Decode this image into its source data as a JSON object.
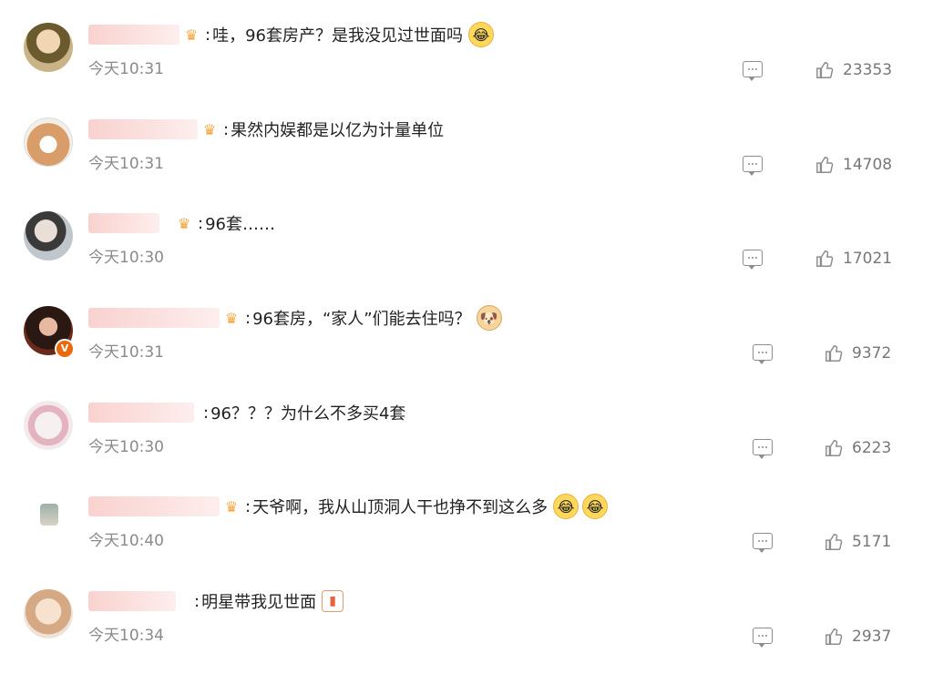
{
  "comments": [
    {
      "avatar": "user-avatar",
      "name_blur_w": 100,
      "vip": true,
      "text": "哇，96套房产？是我没见过世面吗",
      "emojis": [
        "crying-laughing-emoji"
      ],
      "time": "今天10:31",
      "likes": "23353"
    },
    {
      "avatar": "user-avatar",
      "name_blur_w": 120,
      "vip": true,
      "text": "果然内娱都是以亿为计量单位",
      "emojis": [],
      "time": "今天10:31",
      "likes": "14708"
    },
    {
      "avatar": "user-avatar",
      "name_blur_w": 78,
      "vip": true,
      "text": "96套……",
      "emojis": [],
      "time": "今天10:30",
      "likes": "17021"
    },
    {
      "avatar": "user-avatar",
      "name_blur_w": 144,
      "vip": true,
      "verified": "V",
      "text": "96套房，“家人”们能去住吗？",
      "emojis": [
        "doge-emoji"
      ],
      "time": "今天10:31",
      "likes": "9372"
    },
    {
      "avatar": "user-avatar",
      "name_blur_w": 116,
      "vip": false,
      "text": "96？？？为什么不多买4套",
      "emojis": [],
      "time": "今天10:30",
      "likes": "6223"
    },
    {
      "avatar": "user-avatar",
      "name_blur_w": 144,
      "vip": true,
      "text": "天爷啊，我从山顶洞人干也挣不到这么多",
      "emojis": [
        "crying-laughing-emoji",
        "crying-laughing-emoji"
      ],
      "time": "今天10:40",
      "likes": "5171"
    },
    {
      "avatar": "user-avatar",
      "name_blur_w": 96,
      "vip": false,
      "text": "明星带我见世面",
      "emojis": [
        "box-emoji"
      ],
      "time": "今天10:34",
      "likes": "2937"
    }
  ]
}
